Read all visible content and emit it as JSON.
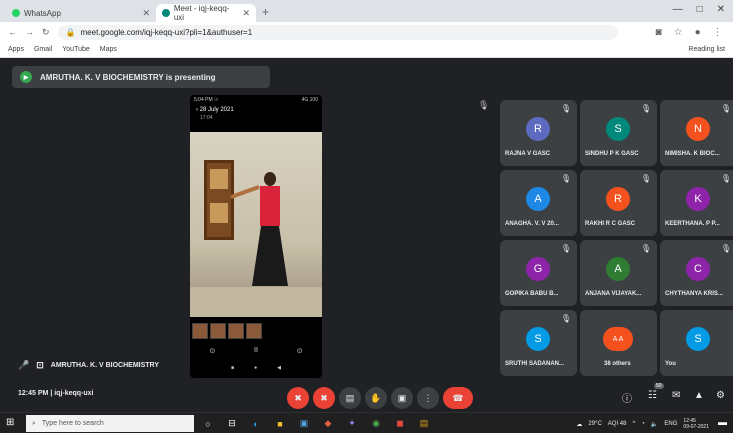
{
  "browser": {
    "tabs": [
      {
        "title": "WhatsApp",
        "favicon_color": "#25d366"
      },
      {
        "title": "Meet - iqj-keqq-uxi",
        "favicon_color": "#00897b"
      }
    ],
    "new_tab": "+",
    "window_controls": [
      "—",
      "□",
      "✕"
    ],
    "url": "meet.google.com/iqj-keqq-uxi?pli=1&authuser=1",
    "nav": [
      "←",
      "→",
      "↻"
    ],
    "bookmarks": [
      "Apps",
      "Gmail",
      "YouTube",
      "Maps"
    ],
    "reading_list": "Reading list"
  },
  "meet": {
    "banner": "AMRUTHA. K. V BIOCHEMISTRY is presenting",
    "phone": {
      "status_left": "5:04 PM ☉",
      "status_right": "4G 100",
      "date": "‹ 28 July 2021",
      "time": "17:04",
      "controls": [
        "⊙",
        "II",
        "⊙"
      ],
      "nav": [
        "■",
        "●",
        "◀"
      ]
    },
    "presenter_name": "AMRUTHA. K. V BIOCHEMISTRY",
    "participants": [
      {
        "initial": "R",
        "name": "RAJNA V GASC",
        "color": "#5c6bc0"
      },
      {
        "initial": "S",
        "name": "SINDHU P K GASC",
        "color": "#00897b"
      },
      {
        "initial": "N",
        "name": "NIMISHA. K BIOC...",
        "color": "#f4511e"
      },
      {
        "initial": "A",
        "name": "ANAGHA. V. V 20...",
        "color": "#1e88e5"
      },
      {
        "initial": "R",
        "name": "RAKHI R C GASC",
        "color": "#f4511e"
      },
      {
        "initial": "K",
        "name": "KEERTHANA. P P...",
        "color": "#8e24aa"
      },
      {
        "initial": "G",
        "name": "GOPIKA BABU B...",
        "color": "#8e24aa"
      },
      {
        "initial": "A",
        "name": "ANJANA VIJAYAK...",
        "color": "#2e7d32"
      },
      {
        "initial": "C",
        "name": "CHYTHANYA KRIS...",
        "color": "#8e24aa"
      },
      {
        "initial": "S",
        "name": "SRUTHI SADANAN...",
        "color": "#039be5"
      },
      {
        "initial": "A A",
        "name": "38 others",
        "color": "#f4511e"
      },
      {
        "initial": "S",
        "name": "You",
        "color": "#039be5"
      }
    ],
    "meeting_time": "12:45 PM",
    "meeting_code": "iqj-keqq-uxi",
    "controls": {
      "mic": "✖",
      "camera": "✖",
      "captions": "▤",
      "raise_hand": "✋",
      "present": "▣",
      "more": "⋮",
      "leave": "☎"
    },
    "right_controls": {
      "info": "ⓘ",
      "people": "☷",
      "chat": "✉",
      "activities": "▲",
      "host": "⚙"
    },
    "people_badge": "50"
  },
  "taskbar": {
    "start": "⊞",
    "search_placeholder": "Type here to search",
    "weather": "29°C",
    "aqi": "AQI 48",
    "lang": "ENG",
    "time": "12:45",
    "date": "09-07-2021"
  }
}
